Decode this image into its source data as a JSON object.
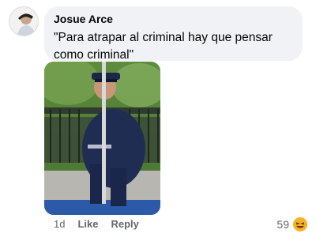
{
  "comment": {
    "author": "Josue Arce",
    "text": "\"Para atrapar al criminal hay que pensar como criminal\""
  },
  "actions": {
    "time": "1d",
    "like_label": "Like",
    "reply_label": "Reply"
  },
  "reactions": {
    "count": "59",
    "icon": "haha-emoji-icon",
    "color": "#f7b125"
  }
}
